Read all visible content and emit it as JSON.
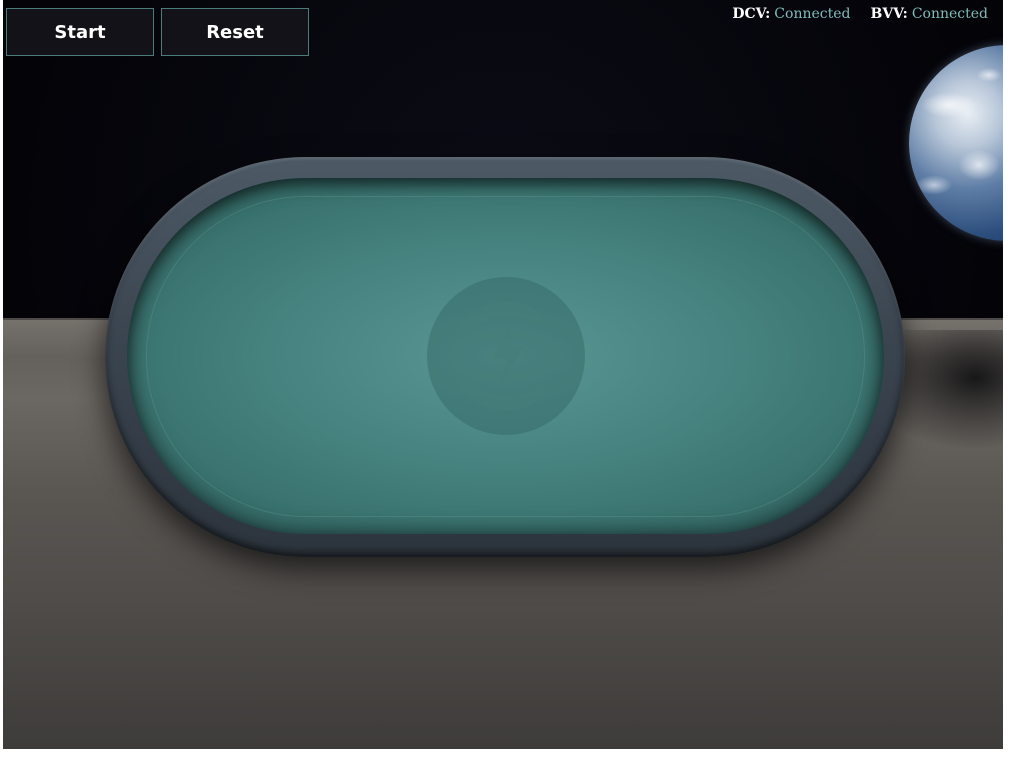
{
  "controls": {
    "start_label": "Start",
    "reset_label": "Reset"
  },
  "status": {
    "dcv": {
      "key": "DCV:",
      "value": "Connected"
    },
    "bvv": {
      "key": "BVV:",
      "value": "Connected"
    }
  },
  "colors": {
    "felt": "#4a8784",
    "rim": "#3b4550",
    "status_value": "#7fbdb8",
    "button_bg": "#121218",
    "button_border": "#4a7d7a"
  },
  "icons": {
    "table_logo": "lightning-bolt-logo-icon"
  }
}
